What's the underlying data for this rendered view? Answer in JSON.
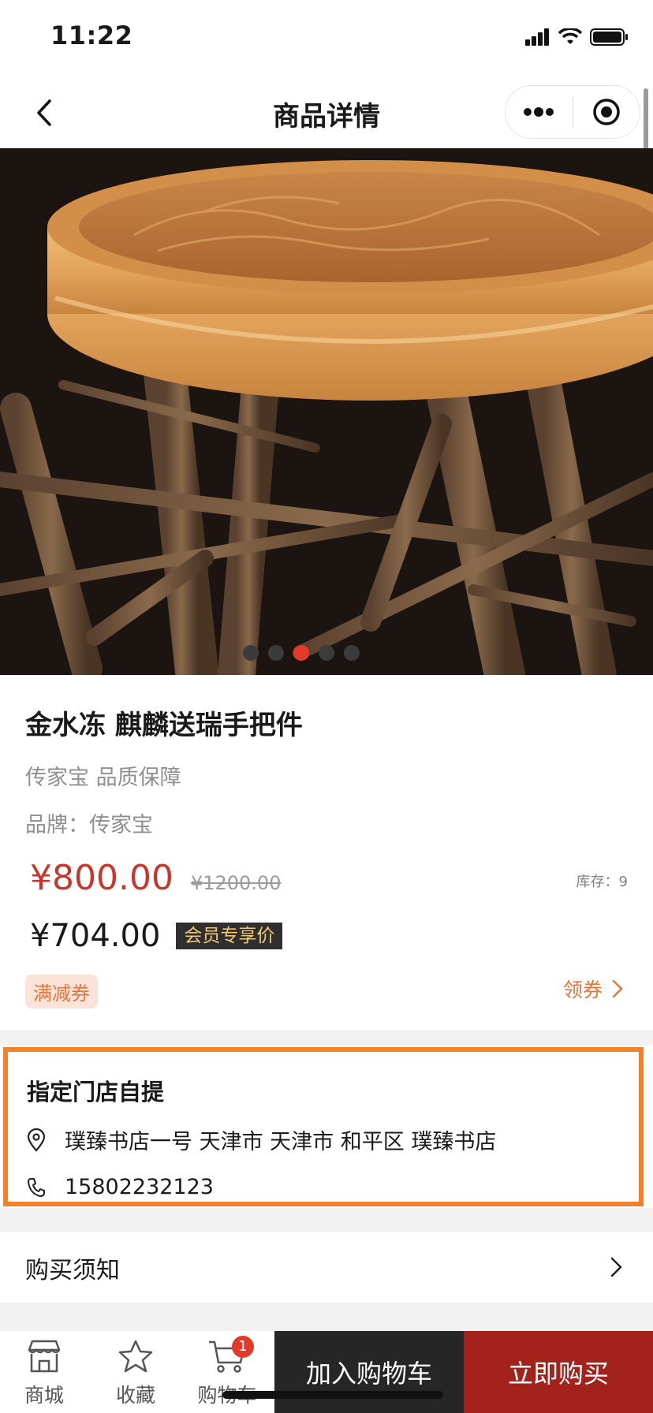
{
  "status_bar": {
    "time": "11:22"
  },
  "nav": {
    "title": "商品详情"
  },
  "carousel": {
    "total": 5,
    "active_index": 2
  },
  "product": {
    "title": "金水冻 麒麟送瑞手把件",
    "subtitle": "传家宝 品质保障",
    "brand": "品牌：传家宝",
    "price": "¥800.00",
    "original_price": "¥1200.00",
    "stock": "库存：9",
    "member_price": "¥704.00",
    "member_tag": "会员专享价",
    "coupon_tag": "满减券",
    "get_coupon": "领券"
  },
  "pickup": {
    "title": "指定门店自提",
    "address": "璞臻书店一号 天津市 天津市 和平区 璞臻书店",
    "phone": "15802232123"
  },
  "notice": {
    "label": "购买须知"
  },
  "bottom_bar": {
    "tabs": [
      {
        "label": "商城",
        "icon": "store-icon"
      },
      {
        "label": "收藏",
        "icon": "star-icon"
      },
      {
        "label": "购物车",
        "icon": "cart-icon",
        "badge": "1"
      }
    ],
    "add_to_cart": "加入购物车",
    "buy_now": "立即购买"
  },
  "colors": {
    "price_red": "#c9372c",
    "buy_button": "#a3231c",
    "cart_button": "#262626",
    "highlight_orange": "#f4802a",
    "coupon_orange": "#e0763b"
  }
}
